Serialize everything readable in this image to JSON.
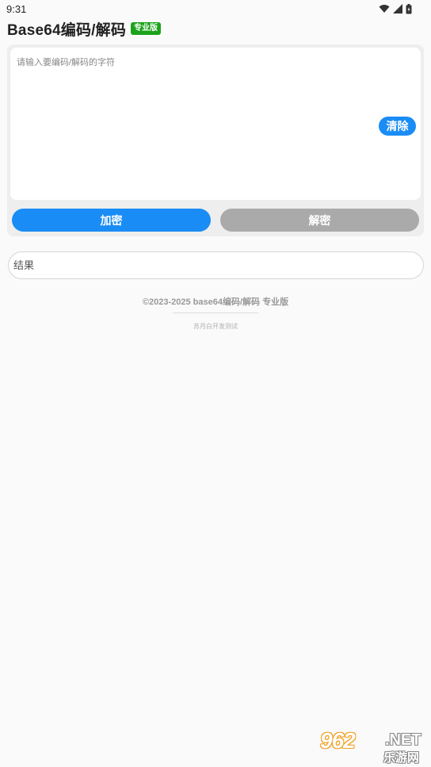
{
  "status_bar": {
    "time": "9:31",
    "icons": [
      "wifi-icon",
      "signal-icon",
      "battery-icon"
    ]
  },
  "header": {
    "title": "Base64编码/解码",
    "badge": "专业版",
    "badge_color": "#1aa31a"
  },
  "input": {
    "placeholder": "请输入要编码/解码的字符",
    "value": "",
    "clear_label": "清除"
  },
  "actions": {
    "encode_label": "加密",
    "decode_label": "解密",
    "accent_color": "#1a8cf5",
    "disabled_color": "#aaaaaa"
  },
  "result": {
    "placeholder": "结果",
    "value": ""
  },
  "footer": {
    "copyright": "©2023-2025 base64编码/解码 专业版",
    "developer": "苏月白开发测试"
  },
  "watermark": {
    "number": "962",
    "domain": ".NET",
    "site_name": "乐游网"
  }
}
